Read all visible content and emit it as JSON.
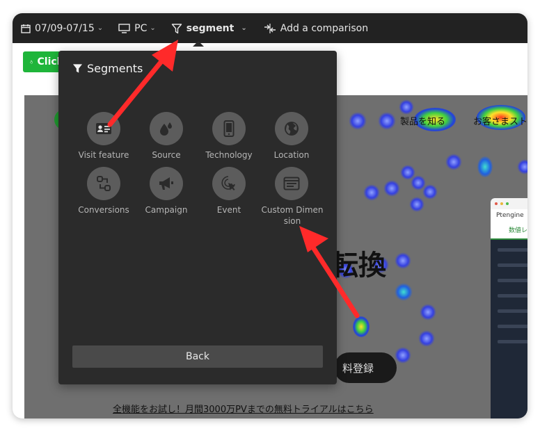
{
  "topbar": {
    "date_range": "07/09-07/15",
    "device": "PC",
    "segment": "segment",
    "comparison": "Add a comparison"
  },
  "toolbar": {
    "click_label": "Click"
  },
  "page_preview": {
    "nav_items": [
      "製品を知る",
      "お客さまスト"
    ],
    "headline_fragment": "転換",
    "cta_fragment": "料登録",
    "trial_link": "全機能をお試し！月間3000万PVまでの無料トライアルはこちら",
    "mock_logo": "Ptengine",
    "mock_tab": "数値レポー"
  },
  "panel": {
    "title": "Segments",
    "options": [
      {
        "label": "Visit feature",
        "icon": "id-card-icon"
      },
      {
        "label": "Source",
        "icon": "droplets-icon"
      },
      {
        "label": "Technology",
        "icon": "phone-icon"
      },
      {
        "label": "Location",
        "icon": "globe-icon"
      },
      {
        "label": "Conversions",
        "icon": "flow-icon"
      },
      {
        "label": "Campaign",
        "icon": "megaphone-icon"
      },
      {
        "label": "Event",
        "icon": "click-target-icon"
      },
      {
        "label": "Custom Dimension",
        "icon": "window-list-icon"
      }
    ],
    "back": "Back"
  },
  "colors": {
    "topbar": "#222222",
    "panel": "#2b2b2b",
    "option_circle": "#5c5c5c",
    "click_button": "#1fb53a",
    "arrow": "#ff2a2a"
  }
}
